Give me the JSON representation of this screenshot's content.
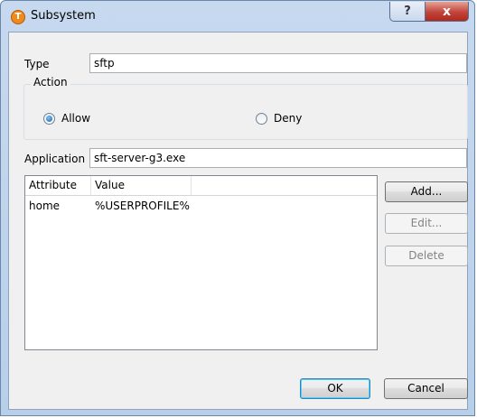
{
  "window": {
    "title": "Subsystem",
    "app_icon_letter": "T",
    "help_glyph": "?",
    "close_glyph": "x"
  },
  "type_field": {
    "label": "Type",
    "value": "sftp"
  },
  "action_group": {
    "title": "Action",
    "options": [
      {
        "label": "Allow",
        "checked": true
      },
      {
        "label": "Deny",
        "checked": false
      }
    ]
  },
  "application_field": {
    "label": "Application",
    "value": "sft-server-g3.exe"
  },
  "attributes_table": {
    "columns": [
      "Attribute",
      "Value"
    ],
    "rows": [
      {
        "attribute": "home",
        "value": "%USERPROFILE%"
      }
    ]
  },
  "side_buttons": {
    "add": "Add...",
    "edit": "Edit...",
    "delete": "Delete"
  },
  "footer_buttons": {
    "ok": "OK",
    "cancel": "Cancel"
  }
}
